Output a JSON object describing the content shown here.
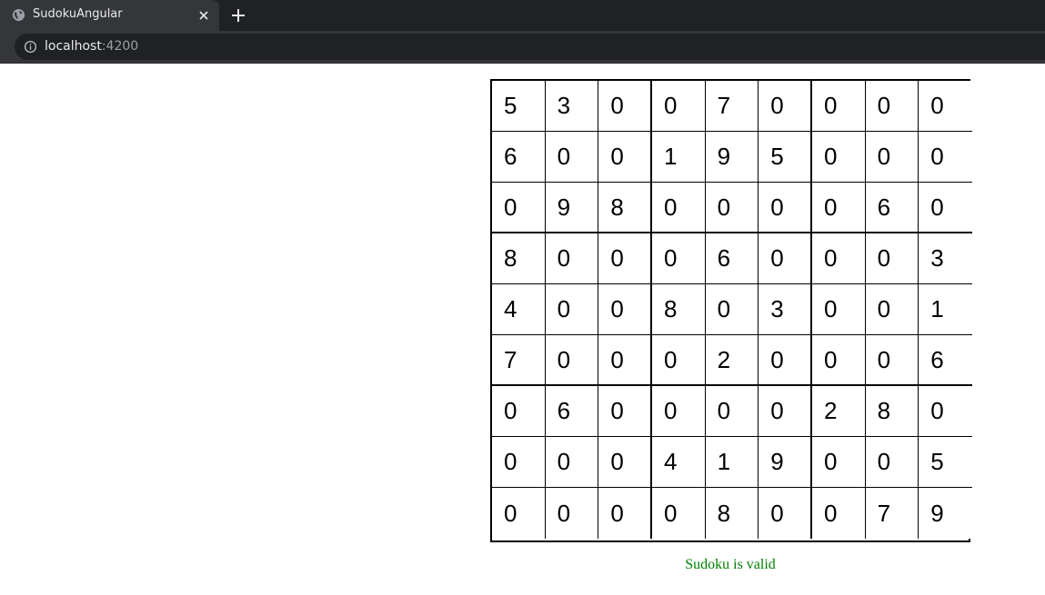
{
  "browser": {
    "tab_title": "SudokuAngular",
    "url_host": "localhost",
    "url_port": ":4200"
  },
  "sudoku": {
    "grid": [
      [
        "5",
        "3",
        "0",
        "0",
        "7",
        "0",
        "0",
        "0",
        "0"
      ],
      [
        "6",
        "0",
        "0",
        "1",
        "9",
        "5",
        "0",
        "0",
        "0"
      ],
      [
        "0",
        "9",
        "8",
        "0",
        "0",
        "0",
        "0",
        "6",
        "0"
      ],
      [
        "8",
        "0",
        "0",
        "0",
        "6",
        "0",
        "0",
        "0",
        "3"
      ],
      [
        "4",
        "0",
        "0",
        "8",
        "0",
        "3",
        "0",
        "0",
        "1"
      ],
      [
        "7",
        "0",
        "0",
        "0",
        "2",
        "0",
        "0",
        "0",
        "6"
      ],
      [
        "0",
        "6",
        "0",
        "0",
        "0",
        "0",
        "2",
        "8",
        "0"
      ],
      [
        "0",
        "0",
        "0",
        "4",
        "1",
        "9",
        "0",
        "0",
        "5"
      ],
      [
        "0",
        "0",
        "0",
        "0",
        "8",
        "0",
        "0",
        "7",
        "9"
      ]
    ],
    "status_text": "Sudoku is valid",
    "status_color": "#008000"
  }
}
